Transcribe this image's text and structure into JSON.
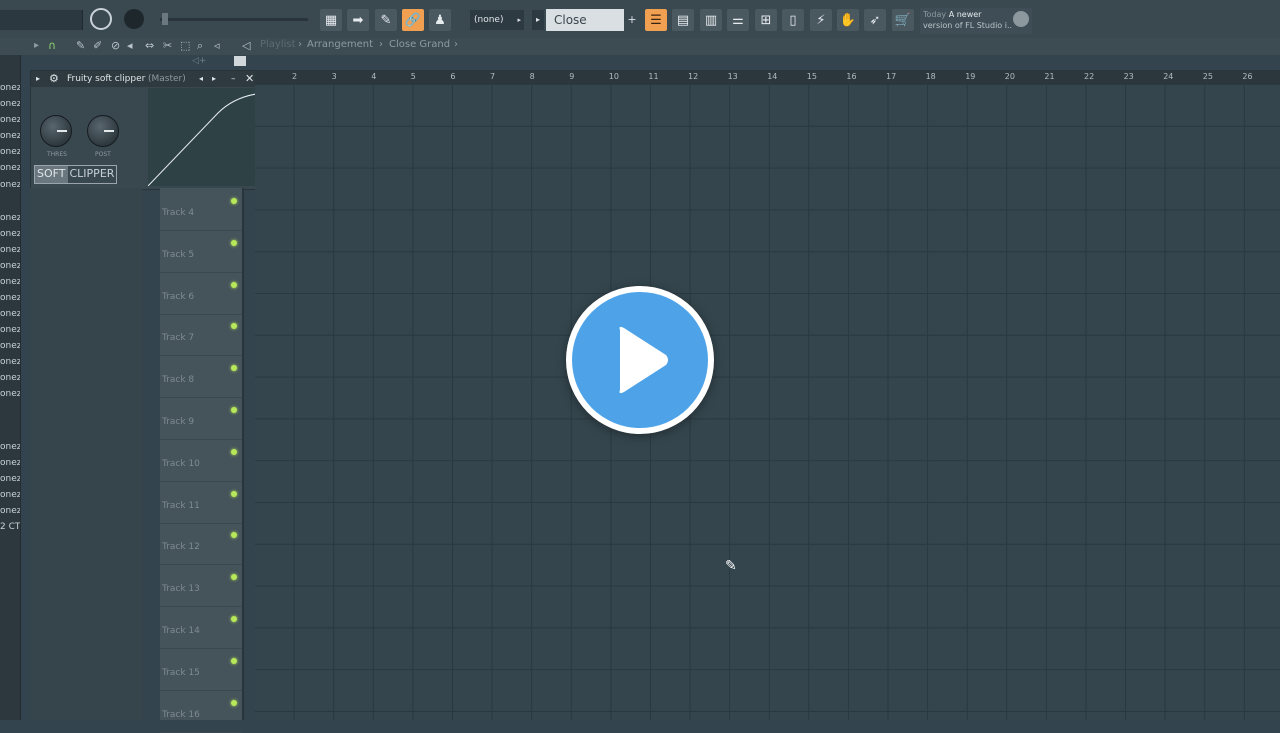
{
  "toolbar": {
    "pattern_selector": "(none)",
    "preset_name": "Close Grand",
    "add_button": "+",
    "news_label": "Today",
    "news_text_1": "A newer",
    "news_text_2": "version of FL Studio i..",
    "buttons": [
      {
        "icon": "piano-icon",
        "glyph": "▦"
      },
      {
        "icon": "arrow-right-icon",
        "glyph": "➡"
      },
      {
        "icon": "pencil-icon",
        "glyph": "✎"
      },
      {
        "icon": "link-icon",
        "glyph": "🔗"
      },
      {
        "icon": "stamp-icon",
        "glyph": "♟"
      }
    ],
    "right_buttons": [
      {
        "icon": "mixer-icon",
        "glyph": "☰"
      },
      {
        "icon": "channel-rack-icon",
        "glyph": "▤"
      },
      {
        "icon": "playlist-icon",
        "glyph": "▥"
      },
      {
        "icon": "piano-roll-icon",
        "glyph": "⚌"
      },
      {
        "icon": "browser-icon",
        "glyph": "⊞"
      },
      {
        "icon": "file-icon",
        "glyph": "▯"
      },
      {
        "icon": "plugin-icon",
        "glyph": "⚡"
      },
      {
        "icon": "hand-icon",
        "glyph": "✋"
      },
      {
        "icon": "bird-icon",
        "glyph": "➶"
      },
      {
        "icon": "cart-icon",
        "glyph": "🛒"
      }
    ]
  },
  "breadcrumb": {
    "playlist": "Playlist",
    "arrangement": "Arrangement",
    "sep": "›",
    "name": "Close Grand",
    "sep2": "›"
  },
  "left_strip": {
    "items": [
      "onez",
      "onez",
      "onez",
      "onez",
      "onez",
      "onez",
      "onez",
      "onez",
      "onez",
      "onez",
      "onez",
      "onez",
      "onez",
      "onez",
      "onez",
      "onez",
      "onez",
      "onez",
      "onez",
      "onez",
      "onez",
      "onez",
      "onez",
      "onez",
      "2 CT"
    ]
  },
  "plugin": {
    "title": "Fruity soft clipper",
    "context": "(Master)",
    "knob_thres": "THRES",
    "knob_post": "POST",
    "label_soft": "SOFT",
    "label_clipper": "CLIPPER"
  },
  "ruler": {
    "numbers": [
      "2",
      "3",
      "4",
      "5",
      "6",
      "7",
      "8",
      "9",
      "10",
      "11",
      "12",
      "13",
      "14",
      "15",
      "16",
      "17",
      "18",
      "19",
      "20",
      "21",
      "22",
      "23",
      "24",
      "25",
      "26"
    ]
  },
  "tracks": [
    "Track 4",
    "Track 5",
    "Track 6",
    "Track 7",
    "Track 8",
    "Track 9",
    "Track 10",
    "Track 11",
    "Track 12",
    "Track 13",
    "Track 14",
    "Track 15",
    "Track 16"
  ]
}
